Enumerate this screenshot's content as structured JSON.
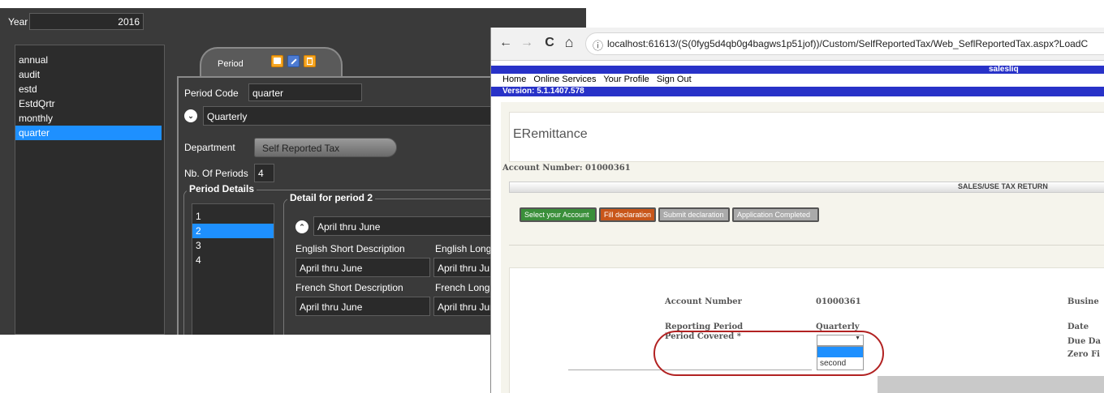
{
  "app": {
    "year_label": "Year",
    "year_value": "2016",
    "period_list": [
      "annual",
      "audit",
      "estd",
      "EstdQrtr",
      "monthly",
      "quarter"
    ],
    "period_list_selected": 5,
    "tab_label": "Period",
    "period_code_label": "Period Code",
    "period_code_value": "quarter",
    "period_name": "Quarterly",
    "department_label": "Department",
    "department_value": "Self Reported Tax",
    "nb_periods_label": "Nb. Of Periods",
    "nb_periods_value": "4",
    "period_details_legend": "Period Details",
    "period_numbers": [
      "1",
      "2",
      "3",
      "4"
    ],
    "period_numbers_selected": 1,
    "detail_legend": "Detail for period 2",
    "detail_name": "April thru June",
    "english_short_label": "English Short Description",
    "english_long_label": "English Long",
    "english_short_value": "April thru June",
    "english_long_value": "April thru Ju",
    "french_short_label": "French Short Description",
    "french_long_label": "French Long I",
    "french_short_value": "April thru June",
    "french_long_value": "April thru Jur",
    "colors": {
      "background": "#3a3a3a",
      "selected": "#1e90ff",
      "icon_accent": "#f5a623"
    },
    "icons": [
      "save-icon",
      "edit-icon",
      "delete-icon",
      "chevron-down-icon",
      "chevron-up-icon"
    ]
  },
  "browser": {
    "nav": {
      "back": "←",
      "forward": "→",
      "reload": "C",
      "home": "⌂",
      "info": "ⓘ"
    },
    "url": "localhost:61613/(S(0fyg5d4qb0g4bagws1p51jof))/Custom/SelfReportedTax/Web_SeflReportedTax.aspx?LoadC",
    "site_title": "salesliq",
    "menu": [
      "Home",
      "Online Services",
      "Your Profile",
      "Sign Out"
    ],
    "version": "Version: 5.1.1407.578",
    "page_title": "ERemittance",
    "account_line": "Account Number: 01000361",
    "section_title": "SALES/USE TAX RETURN",
    "steps": [
      {
        "label": "Select your Account",
        "color": "#3a8f3a"
      },
      {
        "label": "Fill declaration",
        "color": "#c8561a"
      },
      {
        "label": "Submit declaration",
        "color": "#aaaaaa"
      },
      {
        "label": "Application Completed",
        "color": "#aaaaaa"
      }
    ],
    "form": {
      "account_number_label": "Account Number",
      "account_number_value": "01000361",
      "business_label": "Busine",
      "reporting_period_label": "Reporting Period",
      "reporting_period_value": "Quarterly",
      "date_label": "Date",
      "period_covered_label": "Period Covered *",
      "due_date_label": "Due Da",
      "zero_filing_label": "Zero Fi",
      "dropdown_options": [
        "",
        "second"
      ],
      "dropdown_highlighted": 0
    },
    "colors": {
      "band": "#2832c8",
      "highlight_ring": "#b22222",
      "page_bg": "#f5f4ec"
    }
  }
}
